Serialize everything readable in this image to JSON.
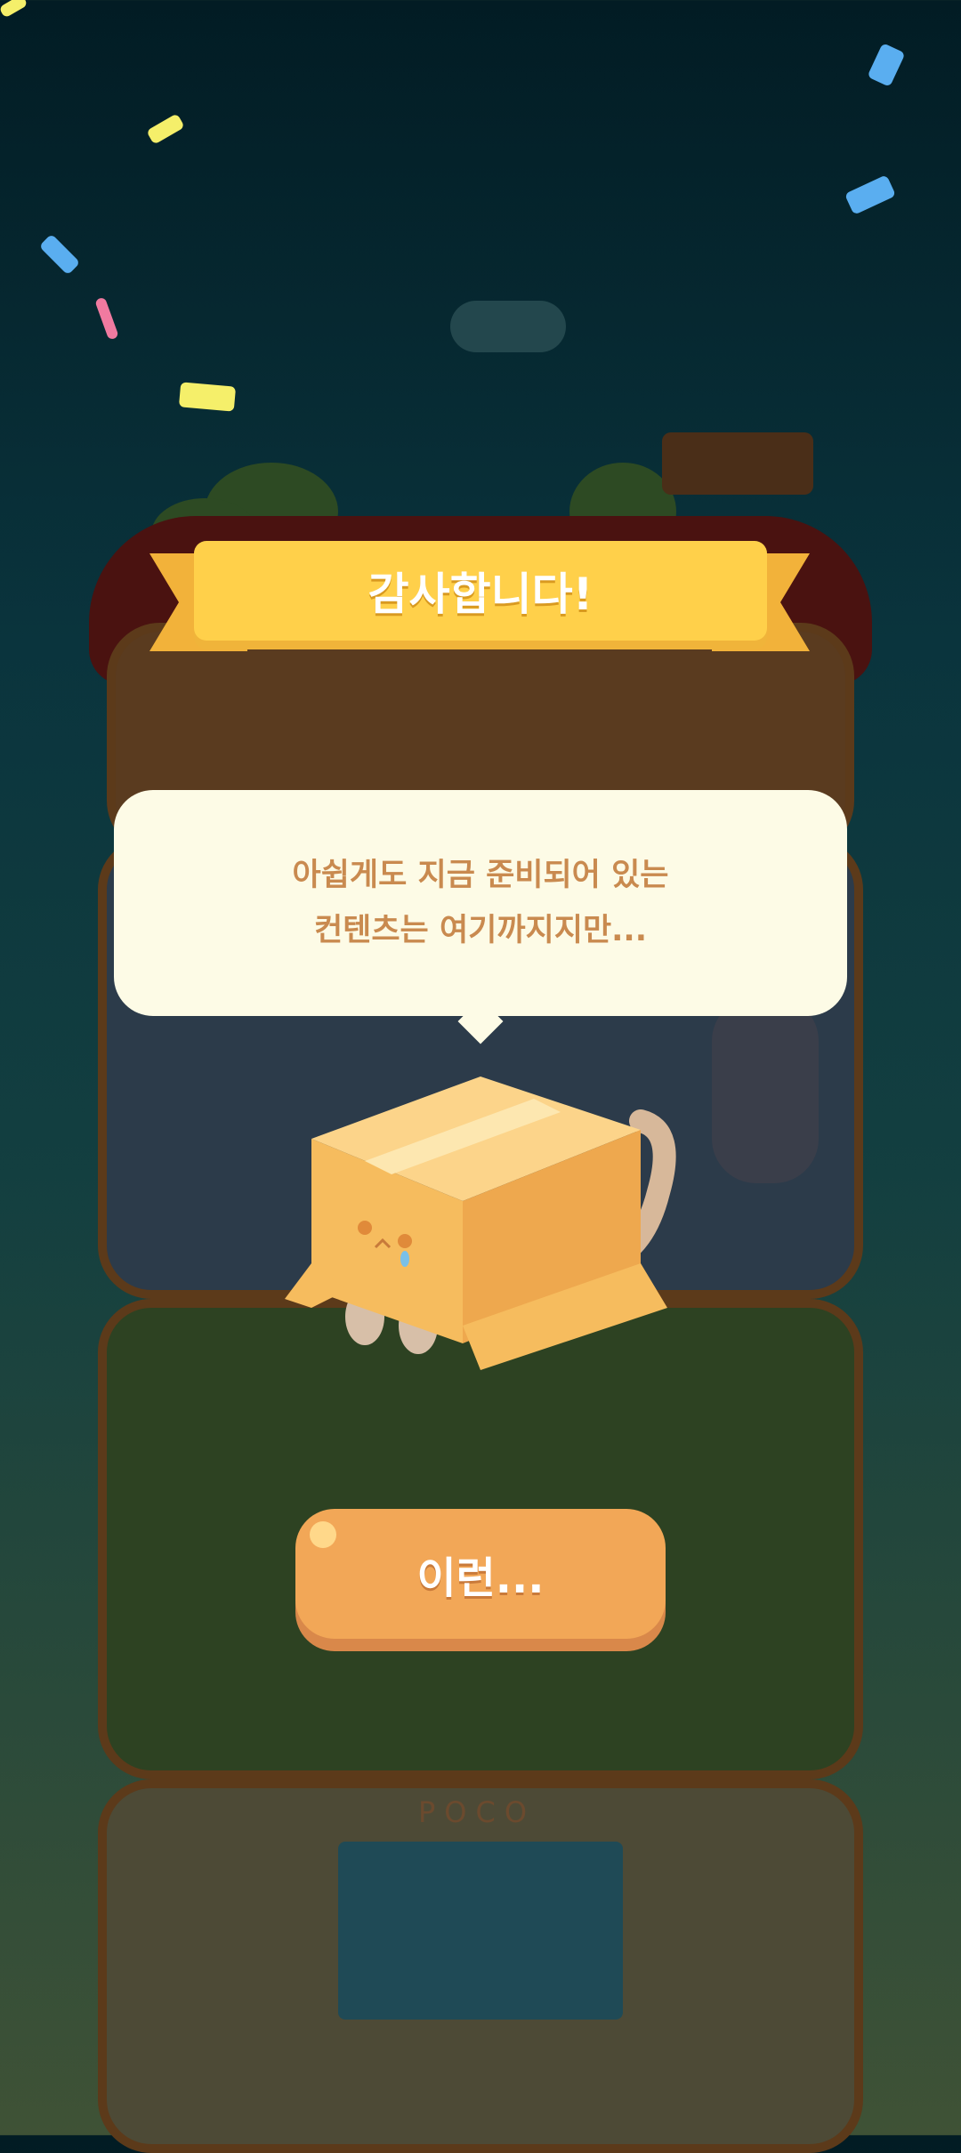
{
  "banner": {
    "title": "감사합니다!"
  },
  "message": {
    "line1": "아쉽게도 지금 준비되어 있는",
    "line2": "컨텐츠는 여기까지지만..."
  },
  "button": {
    "label": "이런..."
  },
  "sign": {
    "text": "POCO"
  },
  "colors": {
    "ribbon": "#ffd04a",
    "button": "#f2a757",
    "bubble": "#fdfbe6",
    "message_text": "#c98a4f"
  }
}
